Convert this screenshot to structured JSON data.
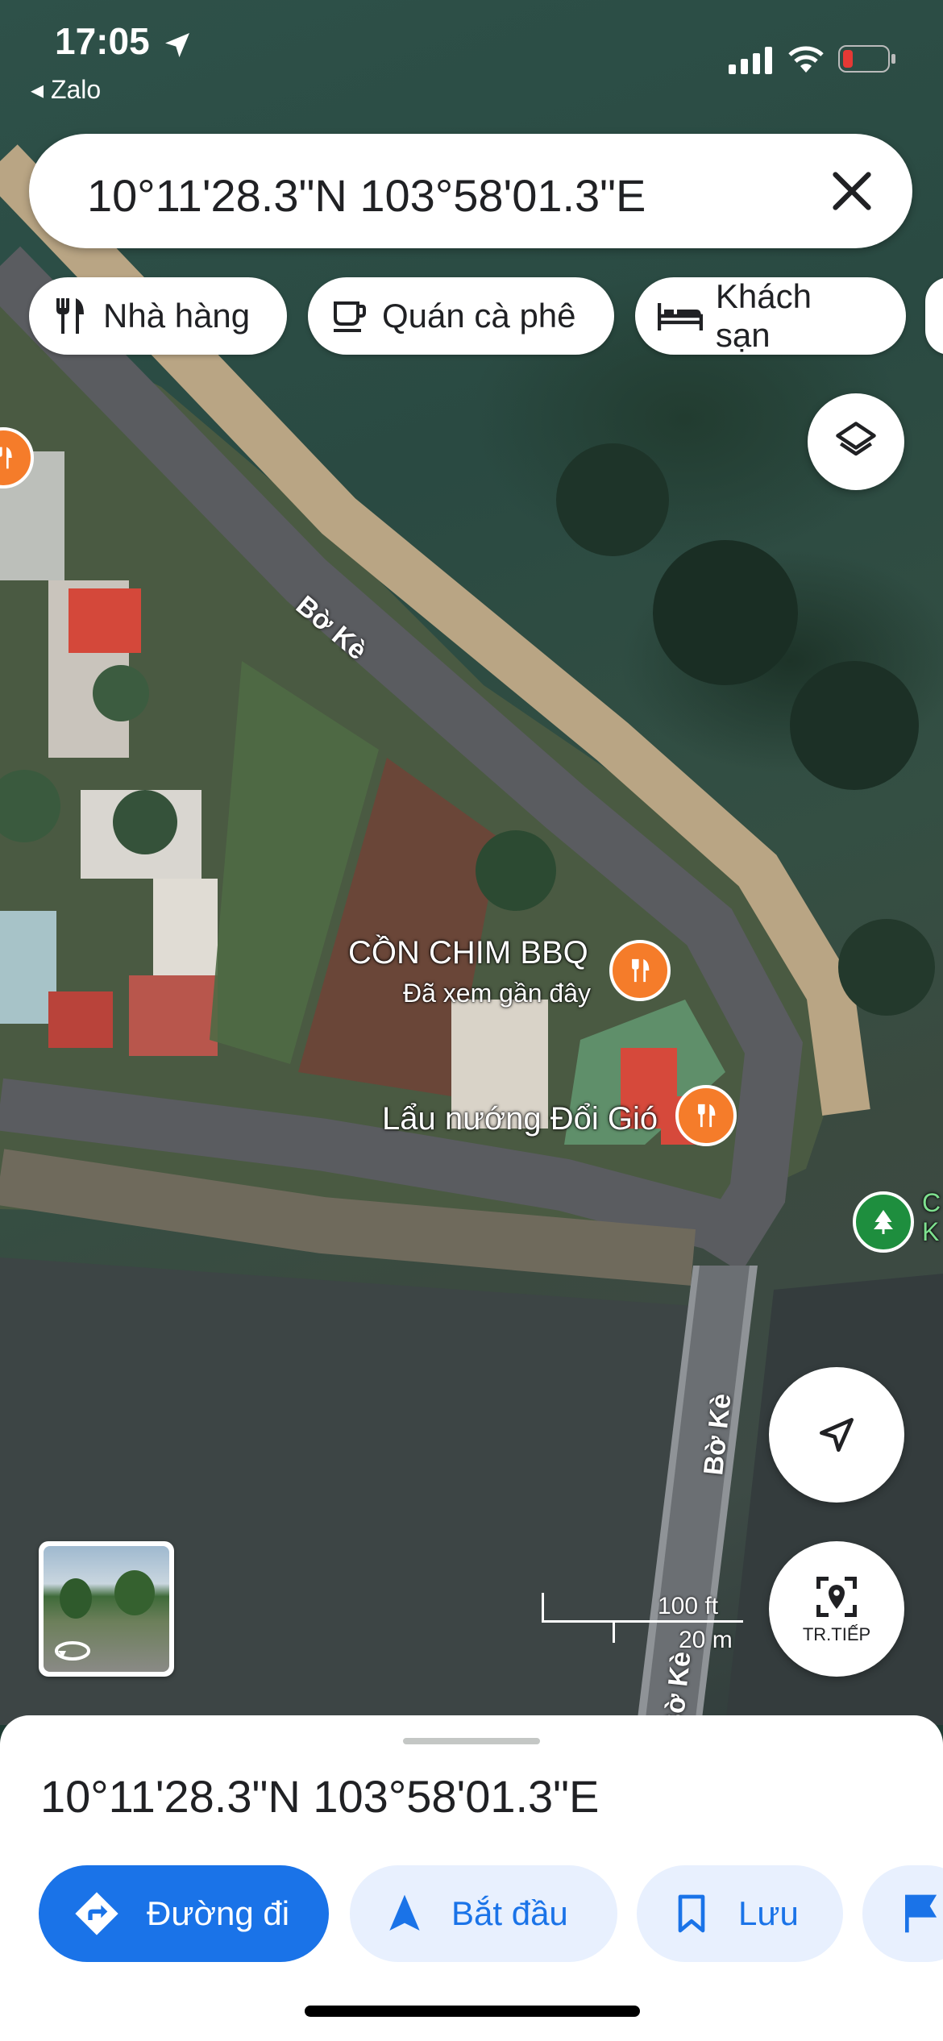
{
  "status": {
    "time": "17:05",
    "back_app": "Zalo"
  },
  "search": {
    "query": "10°11'28.3\"N 103°58'01.3\"E"
  },
  "chips": [
    {
      "label": "Nhà hàng",
      "icon": "fork-knife-icon"
    },
    {
      "label": "Quán cà phê",
      "icon": "coffee-cup-icon"
    },
    {
      "label": "Khách sạn",
      "icon": "bed-icon"
    }
  ],
  "map": {
    "places": [
      {
        "name": "CỒN CHIM BBQ",
        "sub": "Đã xem gần đây"
      },
      {
        "name": "Lẩu nướng Đổi Gió"
      }
    ],
    "partial_place": "C\nK",
    "roads": [
      "Bờ Kè",
      "Bờ Kè",
      "Bờ Kè"
    ],
    "scale": {
      "ft": "100 ft",
      "m": "20 m"
    },
    "nearby_label": "TR.TIẾP"
  },
  "sheet": {
    "coords": "10°11'28.3\"N 103°58'01.3\"E",
    "actions": [
      {
        "label": "Đường đi",
        "icon": "directions-icon"
      },
      {
        "label": "Bắt đầu",
        "icon": "navigation-arrow-icon"
      },
      {
        "label": "Lưu",
        "icon": "bookmark-icon"
      }
    ]
  },
  "colors": {
    "accent": "#1a73e8",
    "pin": "#f57c2a",
    "chip_bg": "#e8f0fe"
  }
}
